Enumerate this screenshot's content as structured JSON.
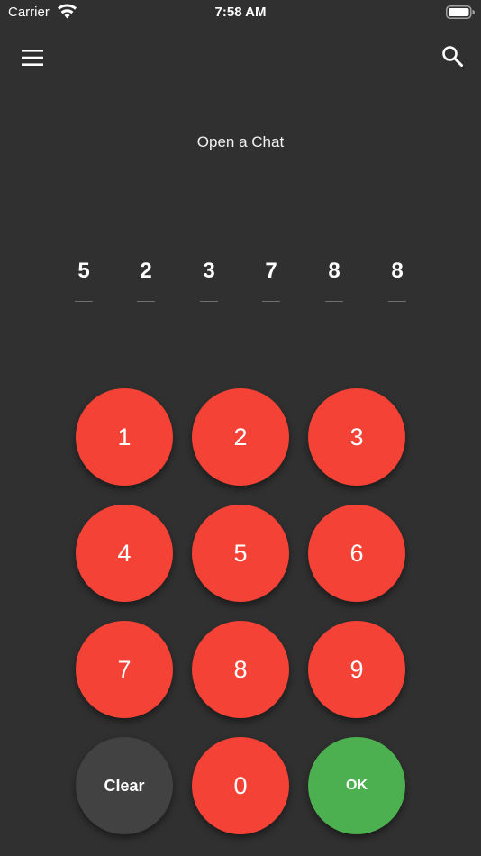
{
  "status_bar": {
    "carrier": "Carrier",
    "time": "7:58 AM"
  },
  "app_bar": {
    "menu_icon": "menu-icon",
    "search_icon": "search-icon"
  },
  "title": "Open a Chat",
  "code": [
    "5",
    "2",
    "3",
    "7",
    "8",
    "8"
  ],
  "keypad": {
    "keys": [
      "1",
      "2",
      "3",
      "4",
      "5",
      "6",
      "7",
      "8",
      "9"
    ],
    "clear_label": "Clear",
    "zero_label": "0",
    "ok_label": "OK"
  },
  "colors": {
    "background": "#303030",
    "key_red": "#f44336",
    "key_clear": "#424242",
    "key_ok": "#4caf50"
  }
}
